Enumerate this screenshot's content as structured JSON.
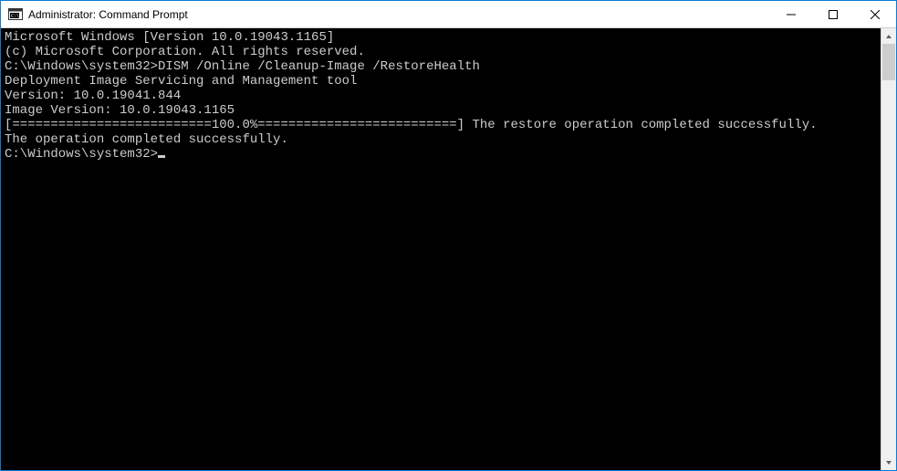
{
  "window": {
    "title": "Administrator: Command Prompt"
  },
  "console": {
    "lines": [
      "Microsoft Windows [Version 10.0.19043.1165]",
      "(c) Microsoft Corporation. All rights reserved.",
      "",
      "C:\\Windows\\system32>DISM /Online /Cleanup-Image /RestoreHealth",
      "",
      "Deployment Image Servicing and Management tool",
      "Version: 10.0.19041.844",
      "",
      "Image Version: 10.0.19043.1165",
      "",
      "[==========================100.0%==========================] The restore operation completed successfully.",
      "The operation completed successfully.",
      ""
    ],
    "prompt": "C:\\Windows\\system32>"
  }
}
